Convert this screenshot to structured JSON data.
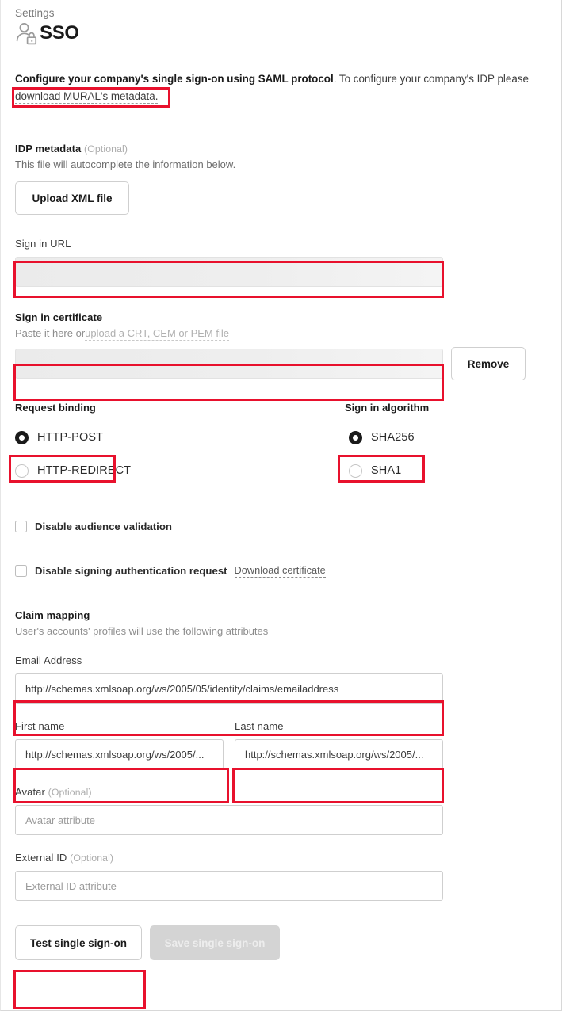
{
  "page": {
    "breadcrumb": "Settings",
    "title": "SSO",
    "icon": "user-lock-icon",
    "accent_red": "#e8112d",
    "bg": "#ffffff"
  },
  "intro": {
    "strong": "Configure your company's single sign-on using SAML protocol",
    "rest": ". To configure your company's IDP please ",
    "link": "download MURAL's metadata."
  },
  "idp_metadata": {
    "label": "IDP metadata",
    "optional": "(Optional)",
    "description": "This file will autocomplete the information below.",
    "upload_button": "Upload XML file"
  },
  "sign_in_url": {
    "label": "Sign in URL",
    "value": "",
    "redacted": true
  },
  "sign_in_certificate": {
    "label": "Sign in certificate",
    "hint_prefix": "Paste it here or",
    "hint_link": "upload a CRT, CEM or PEM file",
    "value": "",
    "redacted": true,
    "remove_button": "Remove"
  },
  "request_binding": {
    "label": "Request binding",
    "options": [
      {
        "label": "HTTP-POST",
        "selected": true
      },
      {
        "label": "HTTP-REDIRECT",
        "selected": false
      }
    ]
  },
  "sign_in_algorithm": {
    "label": "Sign in algorithm",
    "options": [
      {
        "label": "SHA256",
        "selected": true
      },
      {
        "label": "SHA1",
        "selected": false
      }
    ]
  },
  "toggles": [
    {
      "label": "Disable audience validation",
      "checked": false
    },
    {
      "label": "Disable signing authentication request",
      "checked": false,
      "link": "Download certificate"
    }
  ],
  "claim_mapping": {
    "label": "Claim mapping",
    "description": "User's accounts' profiles will use the following attributes",
    "fields": [
      {
        "label": "Email Address",
        "optional": "",
        "value": "http://schemas.xmlsoap.org/ws/2005/05/identity/claims/emailaddress",
        "placeholder": ""
      },
      {
        "label": "First name",
        "optional": "",
        "value": "http://schemas.xmlsoap.org/ws/2005/...",
        "placeholder": ""
      },
      {
        "label": "Last name",
        "optional": "",
        "value": "http://schemas.xmlsoap.org/ws/2005/...",
        "placeholder": ""
      },
      {
        "label": "Avatar",
        "optional": "(Optional)",
        "value": "",
        "placeholder": "Avatar attribute"
      },
      {
        "label": "External ID",
        "optional": "(Optional)",
        "value": "",
        "placeholder": "External ID attribute"
      }
    ]
  },
  "footer": {
    "test_button": "Test single sign-on",
    "save_button": "Save single sign-on",
    "save_disabled": true
  }
}
